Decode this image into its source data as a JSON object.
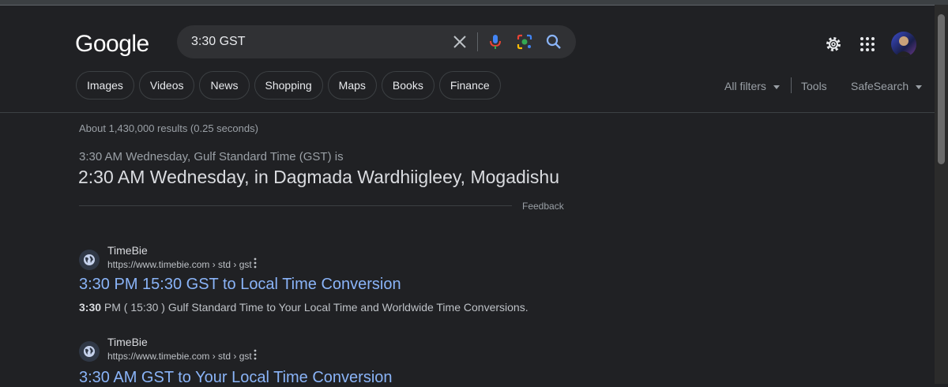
{
  "logo": "Google",
  "search": {
    "query": "3:30 GST"
  },
  "tabs": [
    "Images",
    "Videos",
    "News",
    "Shopping",
    "Maps",
    "Books",
    "Finance"
  ],
  "tools": {
    "all_filters": "All filters",
    "tools": "Tools",
    "safesearch": "SafeSearch"
  },
  "stats": "About 1,430,000 results (0.25 seconds)",
  "conversion": {
    "line1": "3:30 AM Wednesday, Gulf Standard Time (GST) is",
    "line2": "2:30 AM Wednesday, in Dagmada Wardhiigleey, Mogadishu",
    "feedback": "Feedback"
  },
  "results": [
    {
      "site": "TimeBie",
      "url": "https://www.timebie.com › std › gst",
      "title": "3:30 PM 15:30 GST to Local Time Conversion",
      "snippet_bold": "3:30",
      "snippet_rest": " PM ( 15:30 ) Gulf Standard Time to Your Local Time and Worldwide Time Conversions."
    },
    {
      "site": "TimeBie",
      "url": "https://www.timebie.com › std › gst",
      "title": "3:30 AM GST to Your Local Time Conversion"
    }
  ],
  "colors": {
    "background": "#202124",
    "link": "#8ab4f8",
    "chip_border": "#3c4043"
  }
}
